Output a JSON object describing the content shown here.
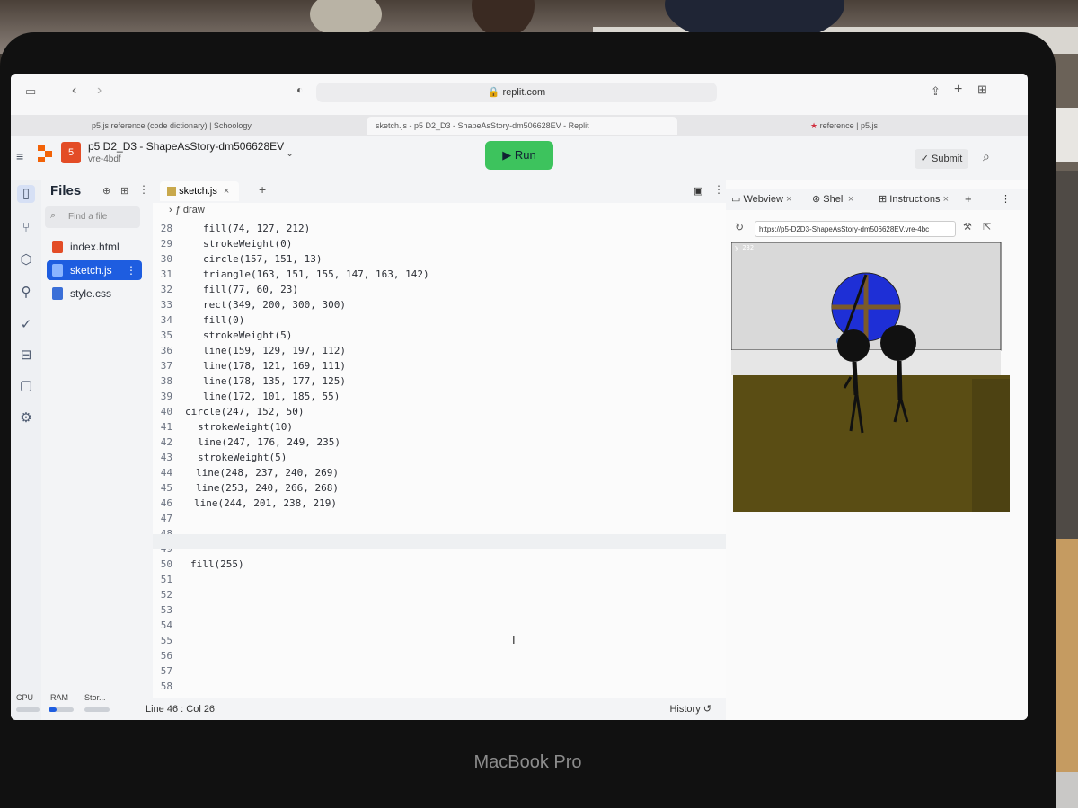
{
  "browser": {
    "url": "replit.com",
    "tabs": [
      {
        "label": "p5.js reference (code dictionary) | Schoology"
      },
      {
        "label": "sketch.js - p5 D2_D3 - ShapeAsStory-dm506628EV - Replit"
      },
      {
        "label": "reference | p5.js"
      }
    ]
  },
  "project": {
    "name": "p5 D2_D3 - ShapeAsStory-dm506628EV",
    "subtitle": "vre-4bdf",
    "run_label": "Run",
    "submit_label": "Submit"
  },
  "files_panel": {
    "title": "Files",
    "search_placeholder": "Find a file",
    "files": [
      "index.html",
      "sketch.js",
      "style.css"
    ],
    "resources": [
      "CPU",
      "RAM",
      "Stor..."
    ]
  },
  "editor": {
    "tab_label": "sketch.js",
    "breadcrumb": "draw",
    "lines": [
      {
        "n": "28",
        "code": "fill(74, 127, 212)"
      },
      {
        "n": "29",
        "code": "strokeWeight(0)"
      },
      {
        "n": "30",
        "code": "circle(157, 151, 13)"
      },
      {
        "n": "31",
        "code": "triangle(163, 151, 155, 147, 163, 142)"
      },
      {
        "n": "32",
        "code": "fill(77, 60, 23)"
      },
      {
        "n": "33",
        "code": "rect(349, 200, 300, 300)"
      },
      {
        "n": "34",
        "code": "fill(0)"
      },
      {
        "n": "35",
        "code": "strokeWeight(5)"
      },
      {
        "n": "36",
        "code": "line(159, 129, 197, 112)"
      },
      {
        "n": "37",
        "code": "line(178, 121, 169, 111)"
      },
      {
        "n": "38",
        "code": "line(178, 135, 177, 125)"
      },
      {
        "n": "39",
        "code": "line(172, 101, 185, 55)"
      },
      {
        "n": "40",
        "code": "circle(247, 152, 50)"
      },
      {
        "n": "41",
        "code": "strokeWeight(10)"
      },
      {
        "n": "42",
        "code": "line(247, 176, 249, 235)"
      },
      {
        "n": "43",
        "code": "strokeWeight(5)"
      },
      {
        "n": "44",
        "code": "line(248, 237, 240, 269)"
      },
      {
        "n": "45",
        "code": "line(253, 240, 266, 268)"
      },
      {
        "n": "46",
        "code": "line(244, 201, 238, 219)"
      },
      {
        "n": "47",
        "code": ""
      },
      {
        "n": "48",
        "code": ""
      },
      {
        "n": "49",
        "code": ""
      },
      {
        "n": "50",
        "code": "fill(255)"
      },
      {
        "n": "51",
        "code": ""
      },
      {
        "n": "52",
        "code": ""
      },
      {
        "n": "53",
        "code": ""
      },
      {
        "n": "54",
        "code": ""
      },
      {
        "n": "55",
        "code": ""
      },
      {
        "n": "56",
        "code": ""
      },
      {
        "n": "57",
        "code": ""
      },
      {
        "n": "58",
        "code": ""
      }
    ],
    "cursor_status": "Line 46 : Col 26",
    "history_label": "History"
  },
  "webview": {
    "tabs": [
      "Webview",
      "Shell",
      "Instructions"
    ],
    "url": "https://p5-D2D3-ShapeAsStory-dm506628EV.vre-4bc",
    "coord_readout": "y 232"
  },
  "device": {
    "brand": "MacBook Pro"
  }
}
